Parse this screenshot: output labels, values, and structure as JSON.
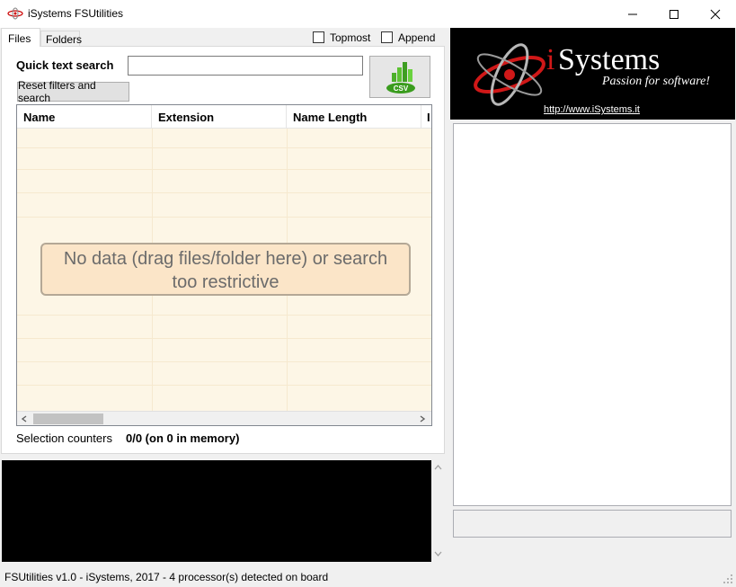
{
  "window": {
    "title": "iSystems FSUtilities"
  },
  "tabs": [
    {
      "label": "Files",
      "active": true
    },
    {
      "label": "Folders",
      "active": false
    }
  ],
  "options": {
    "topmost_label": "Topmost",
    "topmost_checked": false,
    "append_label": "Append",
    "append_checked": false
  },
  "search": {
    "label": "Quick text search",
    "value": "",
    "placeholder": ""
  },
  "buttons": {
    "reset_label": "Reset filters and search",
    "csv_label": "CSV"
  },
  "grid": {
    "columns": [
      "Name",
      "Extension",
      "Name Length",
      "I"
    ],
    "empty_message_line1": "No data (drag files/folder here) or search",
    "empty_message_line2": "too restrictive"
  },
  "selection": {
    "label": "Selection counters",
    "value": "0/0 (on 0 in memory)"
  },
  "logo": {
    "brand_i": "i",
    "brand_rest": "Systems",
    "tagline": "Passion for software!",
    "link": "http://www.iSystems.it"
  },
  "status": {
    "text": "FSUtilities v1.0 - iSystems, 2017 - 4 processor(s) detected on board"
  },
  "colors": {
    "grid_background": "#fdf6e6",
    "logo_background": "#000000",
    "brand_red": "#d01818"
  }
}
